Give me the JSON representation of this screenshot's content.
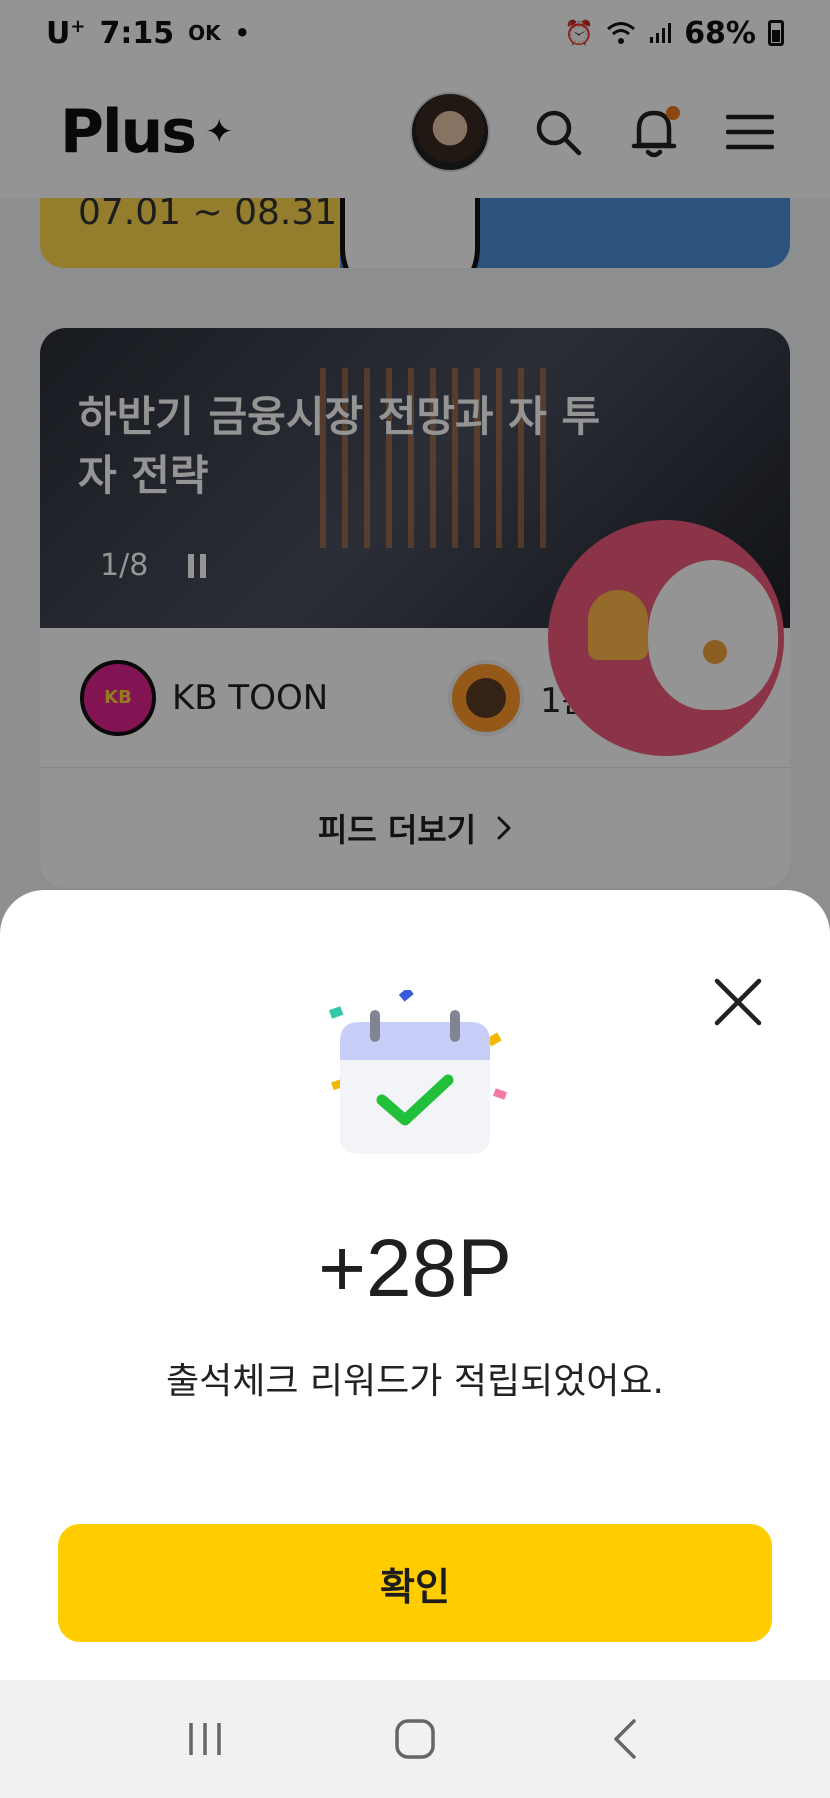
{
  "status_bar": {
    "carrier": "U",
    "carrier_sup": "+",
    "time": "7:15",
    "ok_label": "OK",
    "battery": "68%"
  },
  "header": {
    "logo": "Plus",
    "logo_mark": "✦"
  },
  "banner": {
    "date_range": "07.01 ~ 08.31"
  },
  "feed": {
    "title": "하반기 금융시장 전망과 자 투자 전략",
    "pager": "1/8",
    "sources": [
      {
        "name": "KB TOON",
        "logo_text": "KB TOON"
      },
      {
        "name": "1분 뉴스"
      }
    ],
    "more_label": "피드 더보기"
  },
  "modal": {
    "points": "+28P",
    "message": "출석체크 리워드가 적립되었어요.",
    "confirm_label": "확인"
  },
  "colors": {
    "accent_yellow": "#ffcc00",
    "check_green": "#22c03a",
    "calendar_header": "#c7cff8",
    "notification_dot": "#f07a1a"
  },
  "icons": [
    "search-icon",
    "bell-icon",
    "menu-icon",
    "close-icon",
    "calendar-check-icon",
    "pause-icon",
    "chevron-right-icon",
    "recent-apps-icon",
    "home-icon",
    "back-icon"
  ]
}
